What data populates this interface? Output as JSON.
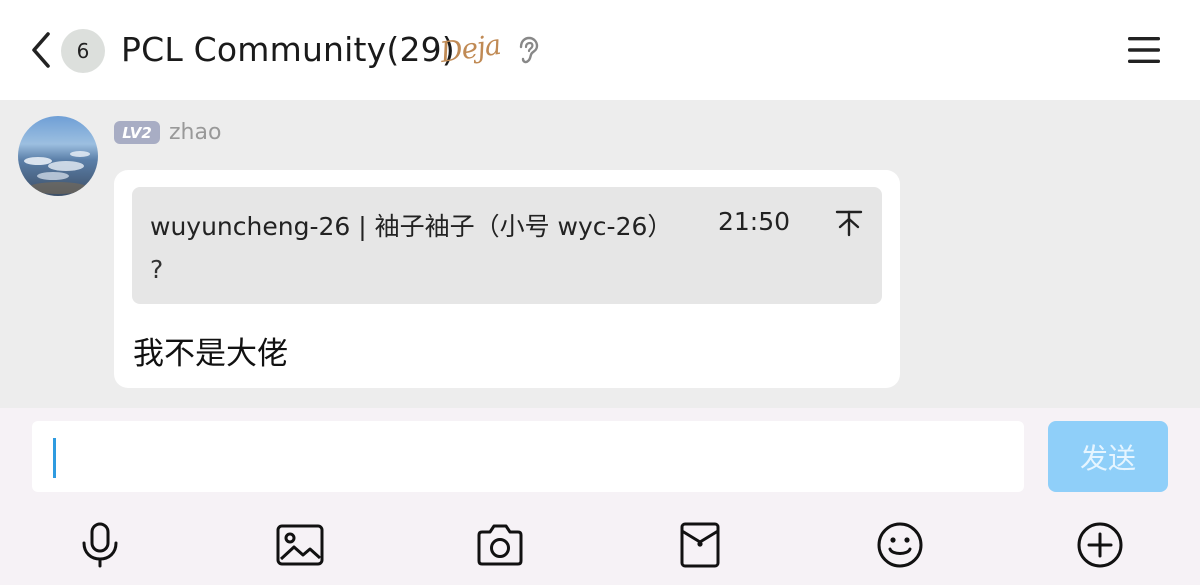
{
  "header": {
    "unread_count": "6",
    "title": "PCL Community(29)",
    "deja_label": "Deja",
    "icons": [
      "back-icon",
      "ear-icon",
      "menu-icon"
    ]
  },
  "message": {
    "level_badge": "LV2",
    "sender": "zhao",
    "quote": {
      "author": "wuyuncheng-26 | 袖子袖子（小号 wyc-26）",
      "time": "21:50",
      "text": "?"
    },
    "text": "我不是大佬"
  },
  "composer": {
    "input_value": "",
    "send_label": "发送"
  },
  "toolbar": {
    "icons": [
      "microphone-icon",
      "image-icon",
      "camera-icon",
      "red-packet-icon",
      "emoji-icon",
      "plus-icon"
    ]
  },
  "colors": {
    "send_button": "#8fcff9",
    "chat_background": "#ededed",
    "composer_background": "#f6f2f6",
    "level_badge": "#a8adc4"
  }
}
